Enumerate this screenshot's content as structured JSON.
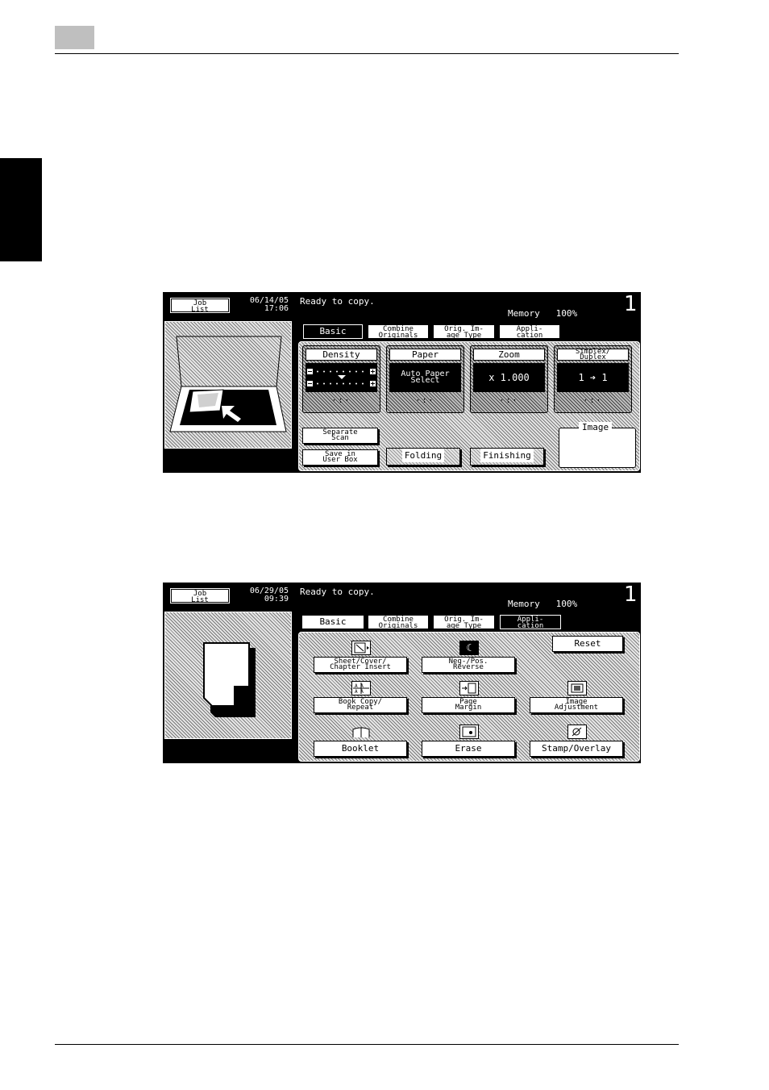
{
  "screen1": {
    "job_list": "Job\nList",
    "date": "06/14/05",
    "time": "17:06",
    "status": "Ready to copy.",
    "memory_label": "Memory",
    "memory_value": "100%",
    "count": "1",
    "tabs": [
      {
        "label": "Basic",
        "active": true
      },
      {
        "label": "Combine\nOriginals",
        "active": false
      },
      {
        "label": "Orig. Im-\nage Type",
        "active": false
      },
      {
        "label": "Appli-\ncation",
        "active": false
      }
    ],
    "functions": [
      {
        "title": "Density",
        "value": ""
      },
      {
        "title": "Paper",
        "value": "Auto Paper\nSelect"
      },
      {
        "title": "Zoom",
        "value": "x 1.000"
      },
      {
        "title": "Simplex/\nDuplex",
        "value": "1 ➔ 1"
      }
    ],
    "buttons": {
      "separate_scan": "Separate\nScan",
      "save_user_box": "Save in\nUser Box",
      "folding": "Folding",
      "finishing": "Finishing"
    },
    "image_label": "Image"
  },
  "screen2": {
    "job_list": "Job\nList",
    "date": "06/29/05",
    "time": "09:39",
    "status": "Ready to copy.",
    "memory_label": "Memory",
    "memory_value": "100%",
    "count": "1",
    "tabs": [
      {
        "label": "Basic",
        "active": false
      },
      {
        "label": "Combine\nOriginals",
        "active": false
      },
      {
        "label": "Orig. Im-\nage Type",
        "active": false
      },
      {
        "label": "Appli-\ncation",
        "active": true
      }
    ],
    "reset": "Reset",
    "items": [
      {
        "label": "Sheet/Cover/\nChapter Insert",
        "icon": "sheet-insert-icon"
      },
      {
        "label": "Neg-/Pos.\nReverse",
        "icon": "neg-pos-icon"
      },
      {
        "label": "Book Copy/\nRepeat",
        "icon": "book-copy-icon"
      },
      {
        "label": "Page\nMargin",
        "icon": "page-margin-icon"
      },
      {
        "label": "Image\nAdjustment",
        "icon": "image-adjust-icon"
      },
      {
        "label": "Booklet",
        "icon": "booklet-icon"
      },
      {
        "label": "Erase",
        "icon": "erase-icon"
      },
      {
        "label": "Stamp/Overlay",
        "icon": "stamp-icon"
      }
    ]
  }
}
